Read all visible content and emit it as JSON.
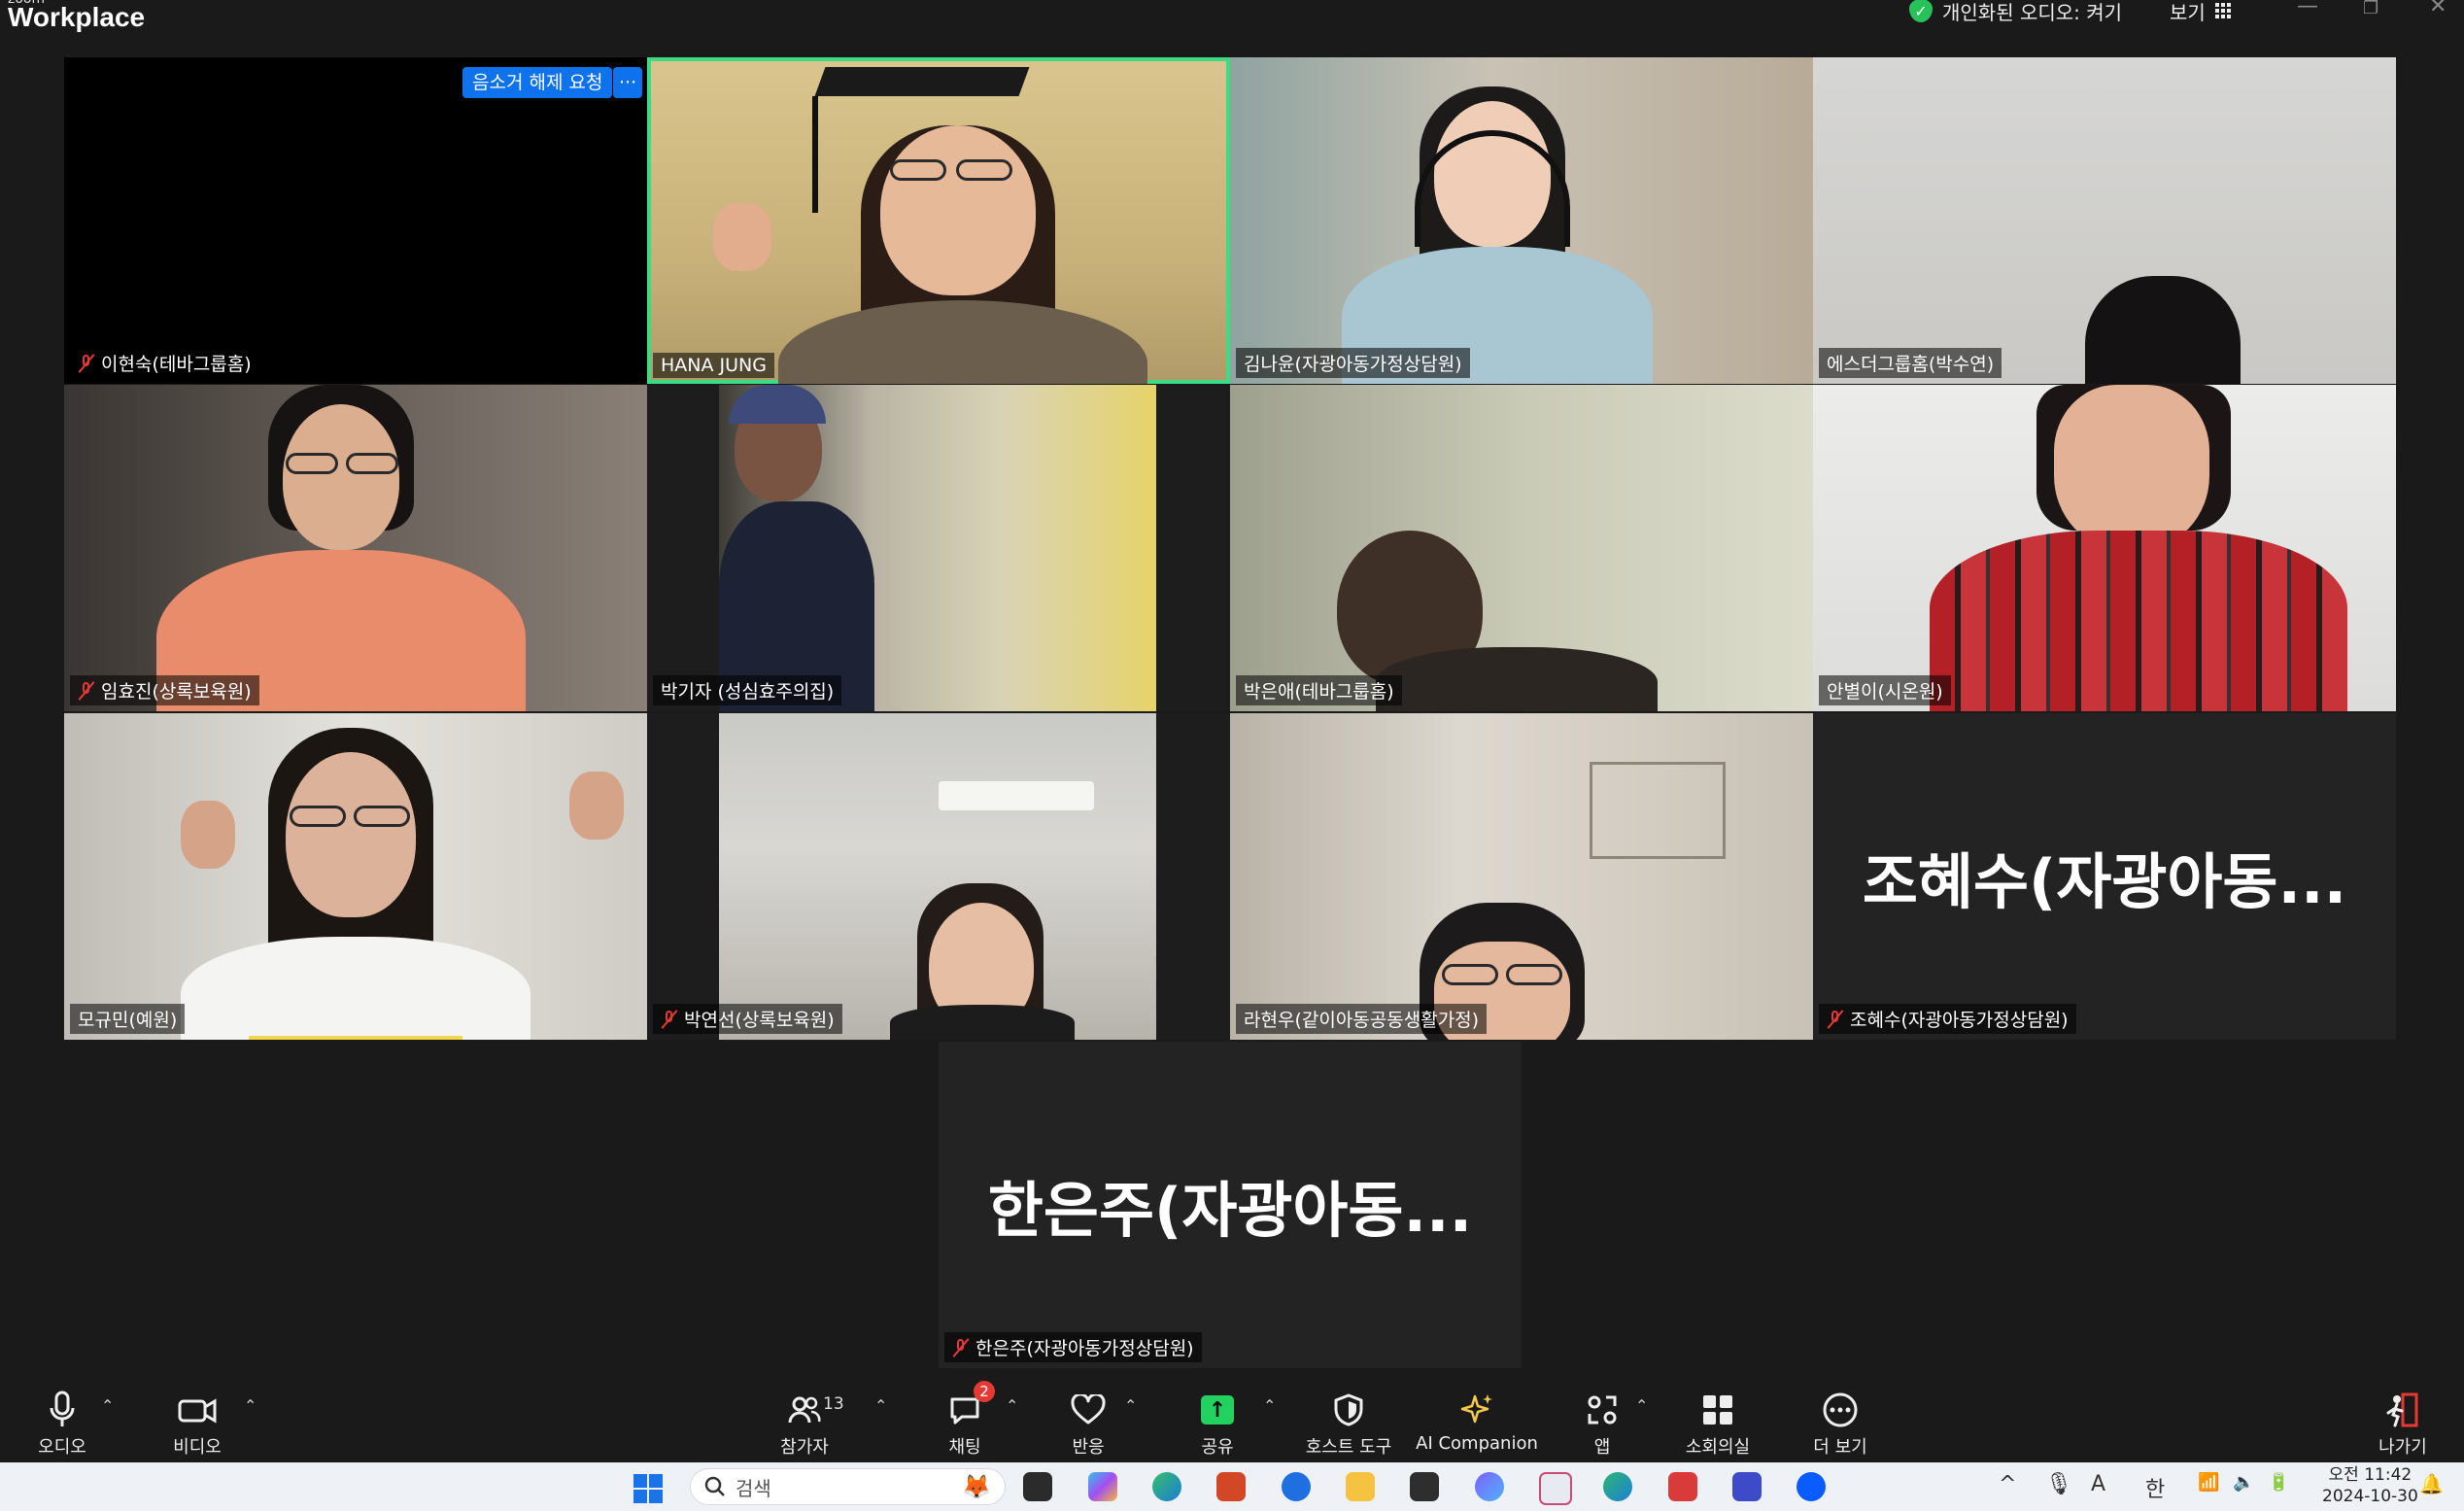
{
  "app": {
    "brand_small": "zoom",
    "brand_big": "Workplace"
  },
  "titlebar": {
    "audio_status": "개인화된 오디오: 켜기",
    "view_label": "보기",
    "icons": [
      "shield-check-icon",
      "grid-icon",
      "minimize-icon",
      "restore-icon",
      "close-icon"
    ]
  },
  "tiles": [
    {
      "name": "이현숙(테바그룹홈)",
      "muted": true,
      "video": false
    },
    {
      "name": "HANA JUNG",
      "muted": false,
      "video": true,
      "active_speaker": true
    },
    {
      "name": "김나윤(자광아동가정상담원)",
      "muted": false,
      "video": true
    },
    {
      "name": "에스더그룹홈(박수연)",
      "muted": false,
      "video": true
    },
    {
      "name": "임효진(상록보육원)",
      "muted": true,
      "video": true
    },
    {
      "name": "박기자 (성심효주의집)",
      "muted": false,
      "video": true
    },
    {
      "name": "박은애(테바그룹홈)",
      "muted": false,
      "video": true
    },
    {
      "name": "안별이(시온원)",
      "muted": false,
      "video": true
    },
    {
      "name": "모규민(예원)",
      "muted": false,
      "video": true
    },
    {
      "name": "박연선(상록보육원)",
      "muted": true,
      "video": true
    },
    {
      "name": "라현우(같이아동공동생활가정)",
      "muted": false,
      "video": true
    },
    {
      "name": "조혜수(자광아동가정상담원)",
      "display_name": "조혜수(자광아동...",
      "muted": true,
      "video": false
    },
    {
      "name": "한은주(자광아동가정상담원)",
      "display_name": "한은주(자광아동...",
      "muted": true,
      "video": false
    }
  ],
  "tile_actions": {
    "unmute_request": "음소거 해제 요청",
    "more": "···"
  },
  "toolbar": {
    "audio": "오디오",
    "video": "비디오",
    "participants": "참가자",
    "participants_count": "13",
    "chat": "채팅",
    "chat_badge": "2",
    "reactions": "반응",
    "share": "공유",
    "host_tools": "호스트 도구",
    "ai_companion": "AI Companion",
    "apps": "앱",
    "breakout": "소회의실",
    "more": "더 보기",
    "leave": "나가기"
  },
  "taskbar": {
    "search_placeholder": "검색",
    "ime": "한",
    "font_indicator": "A",
    "clock_ampm": "오전 11:42",
    "clock_date": "2024-10-30"
  },
  "colors": {
    "active_speaker": "#3ddc84",
    "share_green": "#23d160",
    "zoom_blue": "#0e72ed",
    "mute_red": "#e53935"
  }
}
